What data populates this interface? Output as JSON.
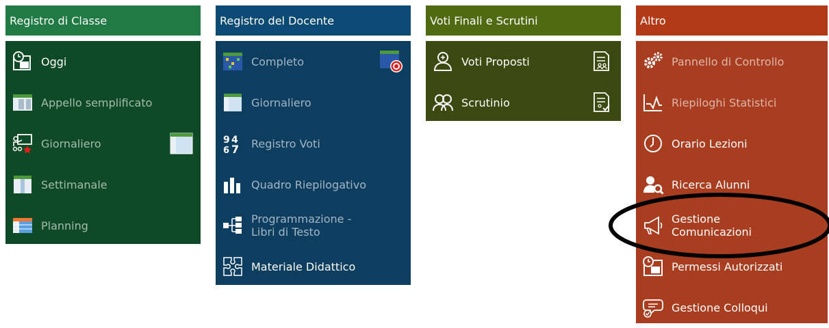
{
  "colors": {
    "classe_header": "#1f7a44",
    "classe_body": "#0f4a26",
    "docente_header": "#0b4a72",
    "docente_body": "#0d3d5f",
    "voti_header": "#4f6a10",
    "voti_body": "#3b4a10",
    "altro_header": "#b23a16",
    "altro_body": "#a83d20",
    "highlight_ellipse": "#000000"
  },
  "registro_classe": {
    "title": "Registro di Classe",
    "items": [
      {
        "label": "Oggi",
        "icon": "calendar-clock-icon"
      },
      {
        "label": "Appello semplificato",
        "icon": "register-grid-icon"
      },
      {
        "label": "Giornaliero",
        "icon": "teacher-board-icon",
        "extra_icon": "grid-sheet-icon"
      },
      {
        "label": "Settimanale",
        "icon": "weekly-grid-icon"
      },
      {
        "label": "Planning",
        "icon": "planning-table-icon"
      }
    ]
  },
  "registro_docente": {
    "title": "Registro del Docente",
    "items": [
      {
        "label": "Completo",
        "icon": "colored-grid-icon",
        "extra_icon": "grid-target-icon"
      },
      {
        "label": "Giornaliero",
        "icon": "sheet-icon"
      },
      {
        "label": "Registro Voti",
        "icon": "grades-numbers-icon"
      },
      {
        "label": "Quadro Riepilogativo",
        "icon": "bar-chart-icon"
      },
      {
        "label": "Programmazione - Libri di Testo",
        "label_line1": "Programmazione -",
        "label_line2": "Libri di Testo",
        "icon": "tree-structure-icon"
      },
      {
        "label": "Materiale Didattico",
        "icon": "puzzle-icon"
      }
    ]
  },
  "voti_finali": {
    "title": "Voti Finali e Scrutini",
    "items": [
      {
        "label": "Voti Proposti",
        "icon": "user-outline-icon",
        "extra_icon": "document-users-icon"
      },
      {
        "label": "Scrutinio",
        "icon": "users-outline-icon",
        "extra_icon": "document-check-icon"
      }
    ]
  },
  "altro": {
    "title": "Altro",
    "items": [
      {
        "label": "Pannello di Controllo",
        "icon": "gears-icon"
      },
      {
        "label": "Riepiloghi Statistici",
        "icon": "line-chart-icon"
      },
      {
        "label": "Orario Lezioni",
        "icon": "clock-icon"
      },
      {
        "label": "Ricerca Alunni",
        "icon": "user-search-icon"
      },
      {
        "label": "Gestione Comunicazioni",
        "label_line1": "Gestione",
        "label_line2": "Comunicazioni",
        "icon": "megaphone-icon"
      },
      {
        "label": "Permessi Autorizzati",
        "icon": "calendar-permit-icon"
      },
      {
        "label": "Gestione Colloqui",
        "icon": "chat-bubbles-icon"
      }
    ]
  }
}
